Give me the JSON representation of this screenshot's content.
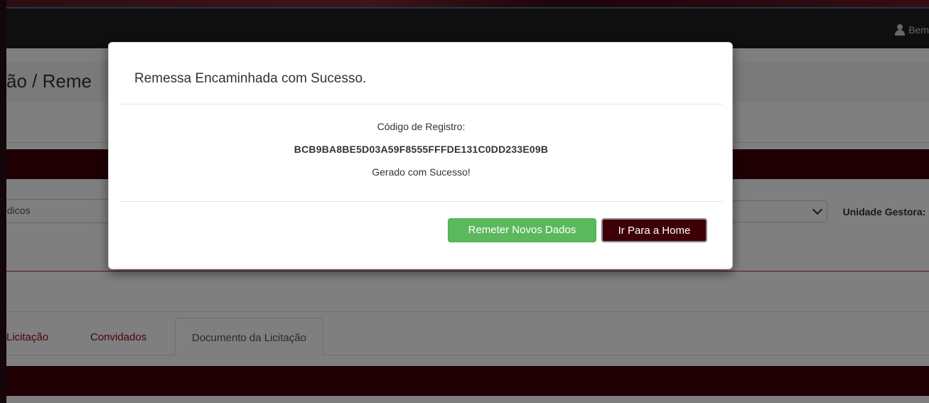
{
  "navbar": {
    "user_text": "Bem"
  },
  "page": {
    "title": "ão /  Reme"
  },
  "form": {
    "left_select_value": "ídicos",
    "unidade_label": "Unidade Gestora:"
  },
  "tabs": [
    {
      "label": "Licitação"
    },
    {
      "label": "Convidados"
    },
    {
      "label": "Documento da Licitação"
    }
  ],
  "modal": {
    "title": "Remessa Encaminhada com Sucesso.",
    "code_label": "Código de Registro:",
    "code_value": "BCB9BA8BE5D03A59F8555FFFDE131C0DD233E09B",
    "success_text": "Gerado com Sucesso!",
    "btn_resend": "Remeter Novos Dados",
    "btn_home": "Ir Para a Home"
  },
  "colors": {
    "brand_dark_red": "#3d0006",
    "success_green": "#5cb85c",
    "tab_link_red": "#8b0a14"
  }
}
